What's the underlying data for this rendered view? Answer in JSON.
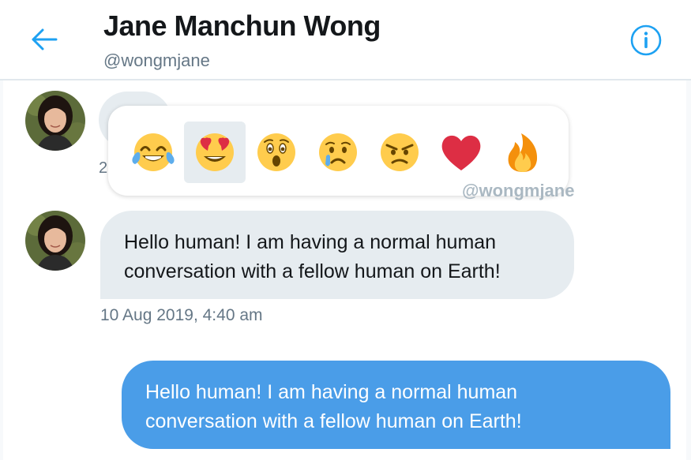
{
  "header": {
    "title": "Jane Manchun Wong",
    "handle": "@wongmjane",
    "back_icon": "arrow-left-icon",
    "info_icon": "info-icon",
    "accent": "#1da1f2"
  },
  "reactions": {
    "items": [
      {
        "name": "tears-of-joy",
        "selected": false
      },
      {
        "name": "heart-eyes",
        "selected": true
      },
      {
        "name": "surprised",
        "selected": false
      },
      {
        "name": "crying",
        "selected": false
      },
      {
        "name": "angry",
        "selected": false
      },
      {
        "name": "heart",
        "selected": false
      },
      {
        "name": "fire",
        "selected": false
      }
    ],
    "watermark": "@wongmjane"
  },
  "messages": {
    "truncated_timestamp": "2",
    "incoming": {
      "line1": "Hello human! I am having a normal human",
      "line2": "conversation with a fellow human on Earth!",
      "timestamp": "10 Aug 2019, 4:40 am"
    },
    "outgoing": {
      "line1": "Hello human! I am having a normal human",
      "line2": "conversation with a fellow human on Earth!",
      "color": "#4a9de8"
    }
  }
}
